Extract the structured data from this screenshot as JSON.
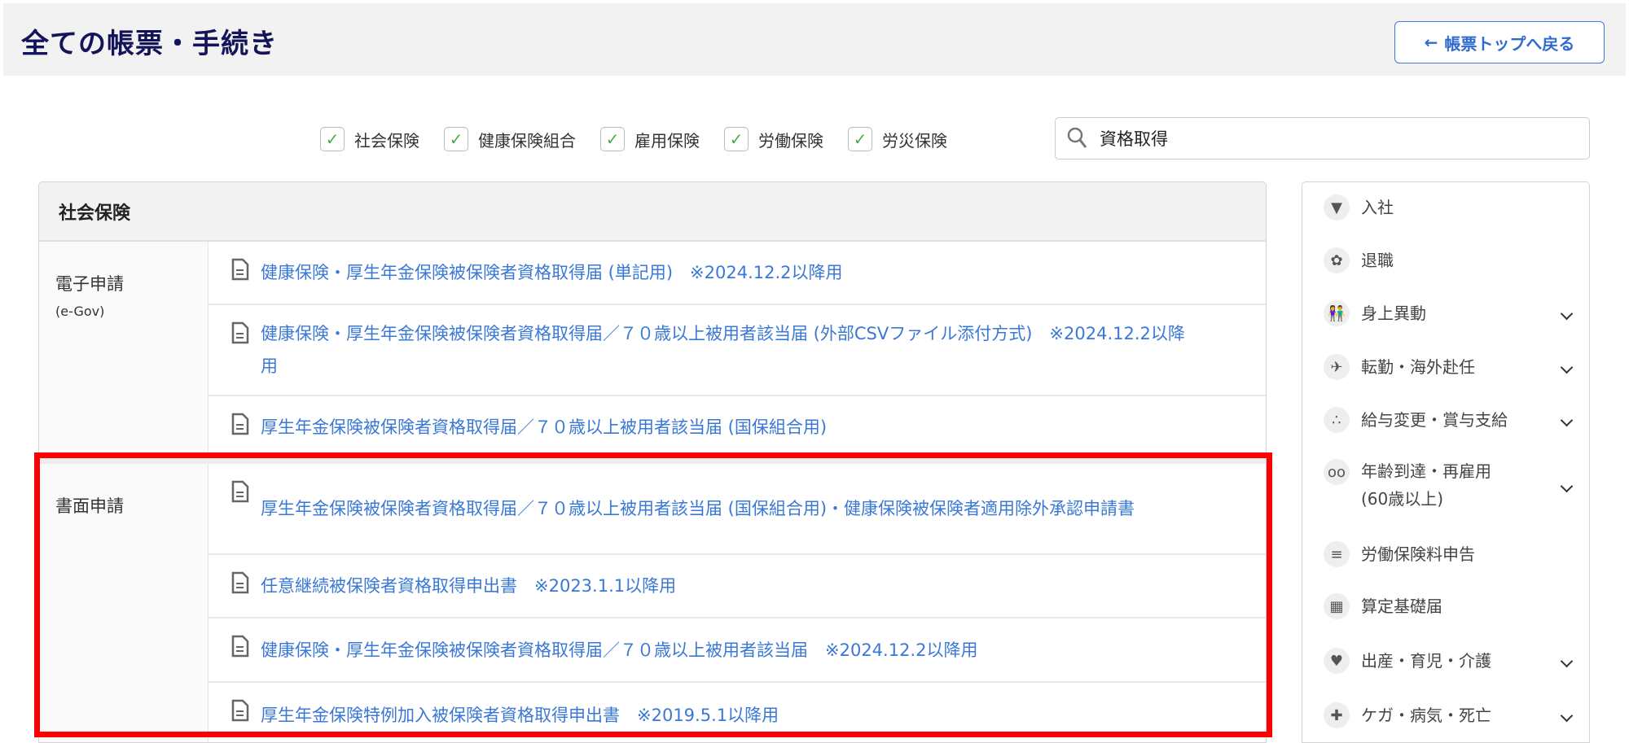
{
  "header": {
    "title": "全ての帳票・手続き",
    "back_label": "帳票トップへ戻る"
  },
  "filters": [
    {
      "label": "社会保険",
      "checked": true
    },
    {
      "label": "健康保険組合",
      "checked": true
    },
    {
      "label": "雇用保険",
      "checked": true
    },
    {
      "label": "労働保険",
      "checked": true
    },
    {
      "label": "労災保険",
      "checked": true
    }
  ],
  "search": {
    "value": "資格取得"
  },
  "panel": {
    "title": "社会保険",
    "groups": [
      {
        "label": "電子申請",
        "sublabel": "(e-Gov)",
        "items": [
          "健康保険・厚生年金保険被保険者資格取得届 (単記用)　※2024.12.2以降用",
          "健康保険・厚生年金保険被保険者資格取得届／７０歳以上被用者該当届 (外部CSVファイル添付方式)　※2024.12.2以降用",
          "厚生年金保険被保険者資格取得届／７０歳以上被用者該当届 (国保組合用)"
        ]
      },
      {
        "label": "書面申請",
        "items": [
          "厚生年金保険被保険者資格取得届／７０歳以上被用者該当届 (国保組合用)・健康保険被保険者適用除外承認申請書",
          "任意継続被保険者資格取得申出書　※2023.1.1以降用",
          "健康保険・厚生年金保険被保険者資格取得届／７０歳以上被用者該当届　※2024.12.2以降用",
          "厚生年金保険特例加入被保険者資格取得申出書　※2019.5.1以降用"
        ]
      }
    ]
  },
  "sidebar": [
    {
      "label": "入社",
      "icon": "tie-icon",
      "expand": false
    },
    {
      "label": "退職",
      "icon": "bouquet-icon",
      "expand": false
    },
    {
      "label": "身上異動",
      "icon": "couple-icon",
      "expand": true
    },
    {
      "label": "転勤・海外赴任",
      "icon": "airplane-icon",
      "expand": true
    },
    {
      "label": "給与変更・賞与支給",
      "icon": "hand-coins-icon",
      "expand": true
    },
    {
      "label": "年齢到達・再雇用\n(60歳以上)",
      "icon": "glasses-icon",
      "expand": true
    },
    {
      "label": "労働保険料申告",
      "icon": "document-icon",
      "expand": false
    },
    {
      "label": "算定基礎届",
      "icon": "calculator-icon",
      "expand": false
    },
    {
      "label": "出産・育児・介護",
      "icon": "heart-icon",
      "expand": true
    },
    {
      "label": "ケガ・病気・死亡",
      "icon": "first-aid-icon",
      "expand": true
    }
  ],
  "colors": {
    "link": "#3a78d6",
    "title": "#14145a",
    "highlight": "#ff0000"
  }
}
